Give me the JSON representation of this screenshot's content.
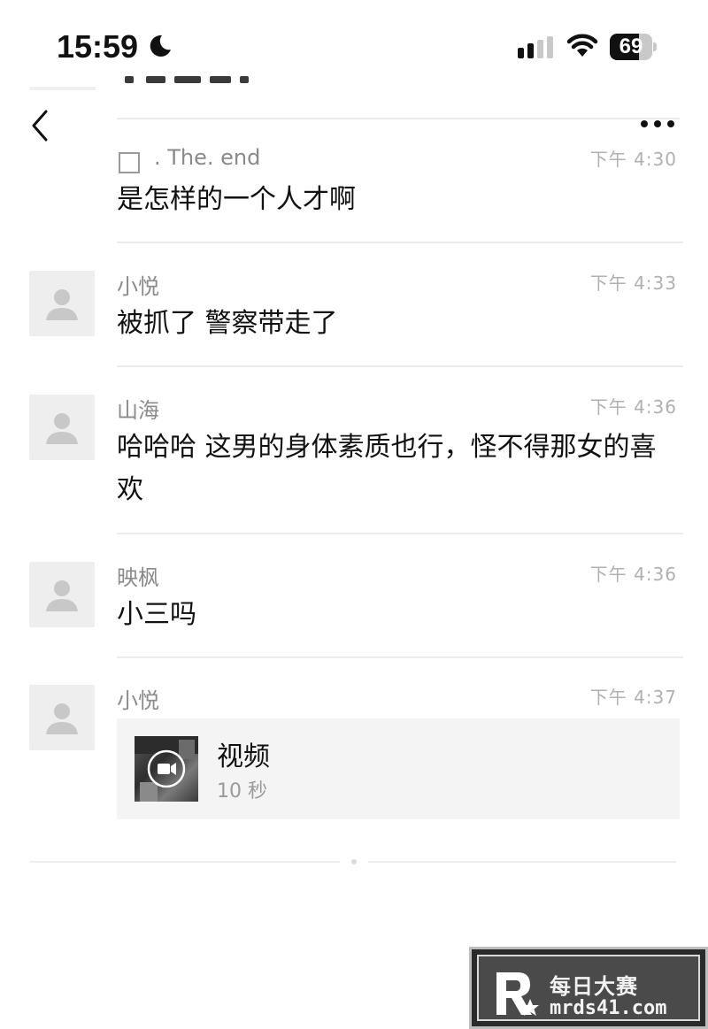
{
  "status_bar": {
    "time": "15:59",
    "battery_level": "69",
    "battery_fraction": 0.69,
    "icons": [
      "moon-icon",
      "signal-icon",
      "wifi-icon",
      "battery-icon"
    ]
  },
  "nav": {
    "back_icon": "chevron-left-icon",
    "more_icon": "more-horizontal-icon"
  },
  "messages": [
    {
      "author": ". The. end",
      "time": "下午 4:30",
      "text": "是怎样的一个人才啊",
      "avatar": "checkbox"
    },
    {
      "author": "小悦",
      "time": "下午 4:33",
      "text": "被抓了 警察带走了",
      "avatar": "default-user-icon"
    },
    {
      "author": "山海",
      "time": "下午 4:36",
      "text": "哈哈哈 这男的身体素质也行，怪不得那女的喜欢",
      "avatar": "default-user-icon"
    },
    {
      "author": "映枫",
      "time": "下午 4:36",
      "text": "小三吗",
      "avatar": "default-user-icon"
    },
    {
      "author": "小悦",
      "time": "下午 4:37",
      "avatar": "default-user-icon",
      "video": {
        "title": "视频",
        "duration": "10 秒",
        "icon": "video-camera-icon"
      }
    }
  ],
  "watermark": {
    "text": "每日大赛",
    "url": "mrds41.com"
  },
  "colors": {
    "background": "#ffffff",
    "text": "#111111",
    "secondary_text": "#8a8a8a",
    "timestamp": "#b0b0b0",
    "divider": "#ececec",
    "avatar_bg": "#eeeeee",
    "card_bg": "#f4f4f4"
  }
}
